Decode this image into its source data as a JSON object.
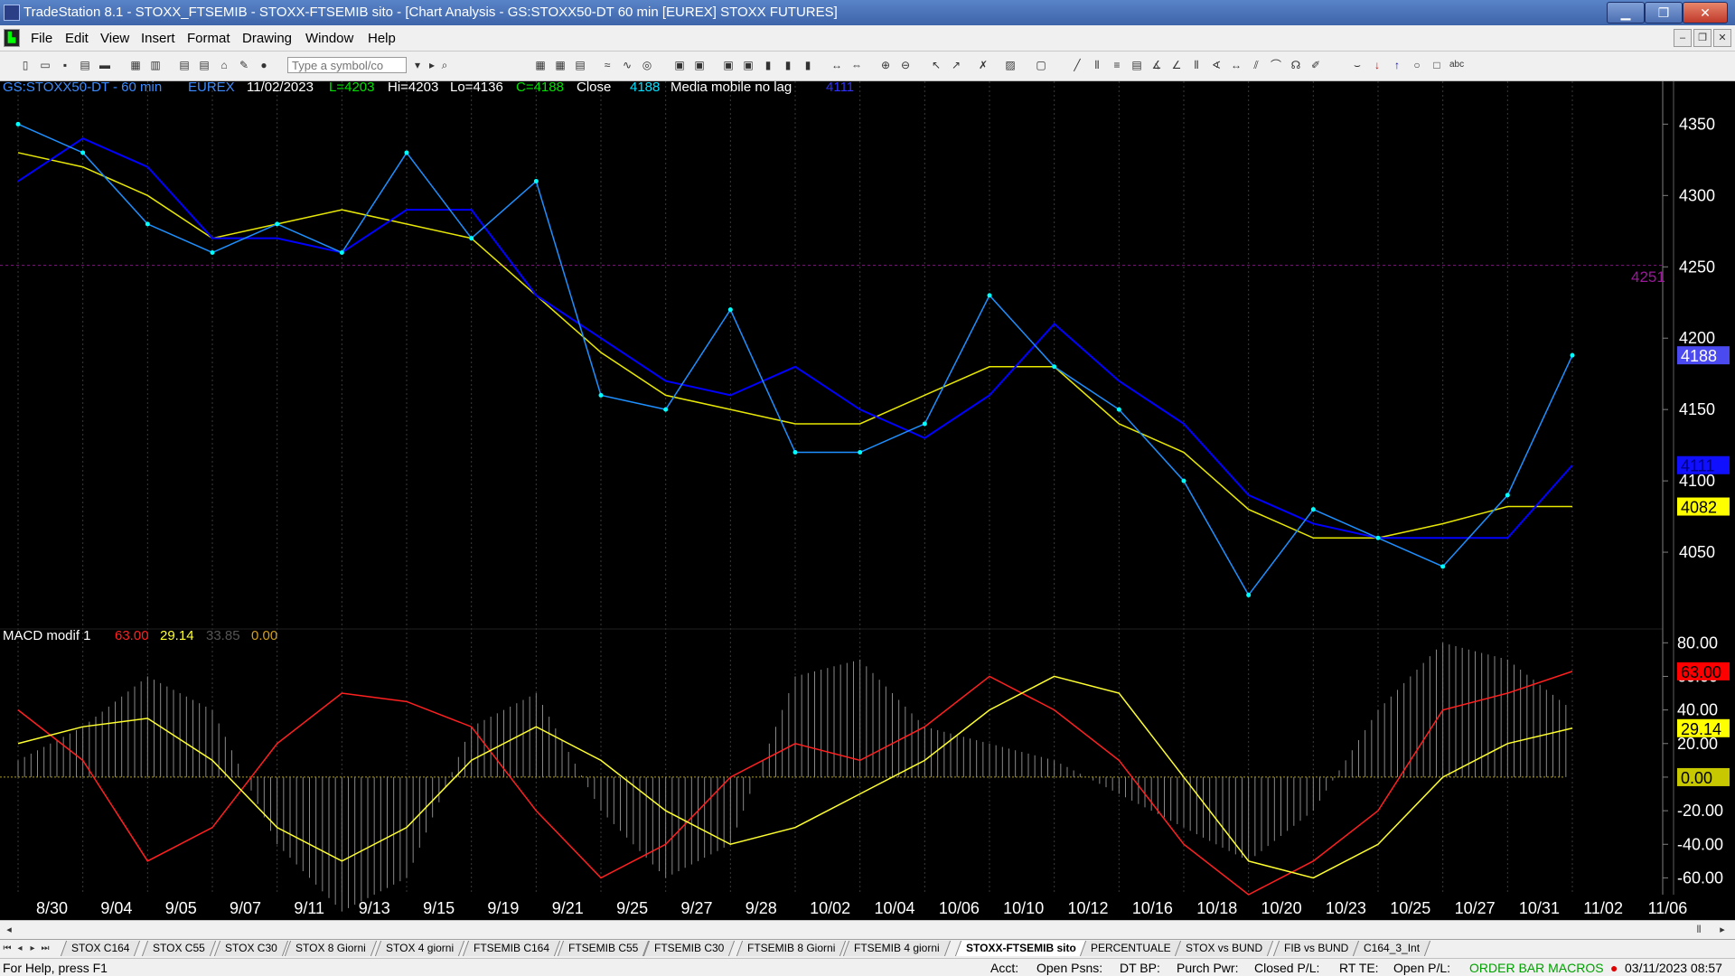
{
  "window": {
    "title": "TradeStation 8.1 - STOXX_FTSEMIB - STOXX-FTSEMIB sito - [Chart Analysis - GS:STOXX50-DT  60 min  [EUREX] STOXX FUTURES]",
    "minimize": "▁",
    "maximize": "❐",
    "close": "✕"
  },
  "menu": [
    "File",
    "Edit",
    "View",
    "Insert",
    "Format",
    "Drawing",
    "Window",
    "Help"
  ],
  "symbol_placeholder": "Type a symbol/co",
  "chart_header": {
    "symbol": "GS:STOXX50-DT - 60 min",
    "exchange": "EUREX",
    "date": "11/02/2023",
    "last": "L=4203",
    "high": "Hi=4203",
    "low": "Lo=4136",
    "close_field": "C=4188",
    "close_label": "Close",
    "close_value": "4188",
    "indicator": "Media mobile no lag",
    "indicator_value": "4111",
    "level_label": "4251"
  },
  "price_axis": {
    "ticks": [
      "4350",
      "4300",
      "4250",
      "4200",
      "4150",
      "4100",
      "4050"
    ],
    "markers": {
      "close": "4188",
      "ma_blue": "4111",
      "ma_yellow": "4082"
    }
  },
  "macd": {
    "label": "MACD modif 1",
    "v1": "63.00",
    "v2": "29.14",
    "v3": "33.85",
    "v4": "0.00",
    "ticks": [
      "80.00",
      "60.00",
      "40.00",
      "20.00",
      "0.00",
      "-20.00",
      "-40.00",
      "-60.00"
    ],
    "markers": {
      "red": "63.00",
      "yellow": "29.14",
      "zero": "0.00"
    }
  },
  "date_axis": [
    "8/30",
    "9/04",
    "9/05",
    "9/07",
    "9/11",
    "9/13",
    "9/15",
    "9/19",
    "9/21",
    "9/25",
    "9/27",
    "9/28",
    "10/02",
    "10/04",
    "10/06",
    "10/10",
    "10/12",
    "10/16",
    "10/18",
    "10/20",
    "10/23",
    "10/25",
    "10/27",
    "10/31",
    "11/02",
    "11/06"
  ],
  "chart_data": {
    "type": "line",
    "ylim": [
      4000,
      4380
    ],
    "x": [
      "8/30",
      "9/04",
      "9/05",
      "9/07",
      "9/11",
      "9/13",
      "9/15",
      "9/19",
      "9/21",
      "9/25",
      "9/27",
      "9/28",
      "10/02",
      "10/04",
      "10/06",
      "10/10",
      "10/12",
      "10/16",
      "10/18",
      "10/20",
      "10/23",
      "10/25",
      "10/27",
      "10/31",
      "11/02"
    ],
    "series": [
      {
        "name": "Close",
        "values": [
          4350,
          4330,
          4280,
          4260,
          4280,
          4260,
          4330,
          4270,
          4310,
          4160,
          4150,
          4220,
          4120,
          4120,
          4140,
          4230,
          4180,
          4150,
          4100,
          4020,
          4080,
          4060,
          4040,
          4090,
          4188
        ]
      },
      {
        "name": "Media mobile no lag",
        "values": [
          4310,
          4340,
          4320,
          4270,
          4270,
          4260,
          4290,
          4290,
          4230,
          4200,
          4170,
          4160,
          4180,
          4150,
          4130,
          4160,
          4210,
          4170,
          4140,
          4090,
          4070,
          4060,
          4060,
          4060,
          4111
        ]
      },
      {
        "values": [
          4330,
          4320,
          4300,
          4270,
          4280,
          4290,
          4280,
          4270,
          4230,
          4190,
          4160,
          4150,
          4140,
          4140,
          4160,
          4180,
          4180,
          4140,
          4120,
          4080,
          4060,
          4060,
          4070,
          4082,
          4082
        ]
      }
    ],
    "macd": {
      "ylim": [
        -70,
        85
      ],
      "red": [
        40,
        10,
        -50,
        -30,
        20,
        50,
        45,
        30,
        -20,
        -60,
        -40,
        0,
        20,
        10,
        30,
        60,
        40,
        10,
        -40,
        -70,
        -50,
        -20,
        40,
        50,
        63
      ],
      "yellow": [
        20,
        30,
        35,
        10,
        -30,
        -50,
        -30,
        10,
        30,
        10,
        -20,
        -40,
        -30,
        -10,
        10,
        40,
        60,
        50,
        0,
        -50,
        -60,
        -40,
        0,
        20,
        29.14
      ],
      "histogram": [
        10,
        30,
        60,
        40,
        -40,
        -80,
        -60,
        30,
        50,
        -20,
        -60,
        -40,
        60,
        70,
        30,
        20,
        10,
        -10,
        -30,
        -50,
        -20,
        40,
        80,
        70,
        40
      ]
    }
  },
  "tabs": [
    "STOX C164",
    "STOX C55",
    "STOX  C30",
    "STOX  8 Giorni",
    "STOX 4 giorni",
    "FTSEMIB C164",
    "FTSEMIB C55",
    "FTSEMIB C30",
    "FTSEMIB  8 Giorni",
    "FTSEMIB  4 giorni",
    "STOXX-FTSEMIB sito",
    "PERCENTUALE",
    "STOX vs BUND",
    "FIB vs BUND",
    "C164_3_Int"
  ],
  "active_tab": "STOXX-FTSEMIB sito",
  "status": {
    "help": "For Help, press F1",
    "acct": "Acct:",
    "open_psns": "Open Psns:",
    "dt_bp": "DT BP:",
    "purch_pwr": "Purch Pwr:",
    "closed_pl": "Closed P/L:",
    "rt_te": "RT TE:",
    "open_pl": "Open P/L:",
    "macros": "ORDER BAR  MACROS",
    "datetime": "03/11/2023 08:57"
  },
  "colors": {
    "blue_ma": "#0000ff",
    "yellow_ma": "#e8e800",
    "close_line": "#1e90ff",
    "dots": "#00ffff",
    "macd_red": "#ff2020",
    "macd_yellow": "#ffff30",
    "histogram": "#888888"
  }
}
